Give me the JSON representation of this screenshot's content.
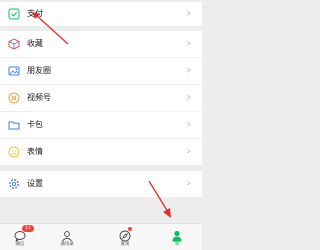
{
  "menu": {
    "pay": {
      "label": "支付",
      "icon": "wechat-pay-icon",
      "color": "#07c160"
    },
    "favorites": {
      "label": "收藏",
      "icon": "favorites-cube-icon"
    },
    "moments": {
      "label": "朋友圈",
      "icon": "moments-image-icon"
    },
    "channels": {
      "label": "视频号",
      "icon": "channels-icon"
    },
    "cards": {
      "label": "卡包",
      "icon": "card-wallet-icon"
    },
    "stickers": {
      "label": "表情",
      "icon": "sticker-smile-icon"
    },
    "settings": {
      "label": "设置",
      "icon": "settings-gear-icon"
    }
  },
  "tabbar": {
    "chats": {
      "label": "微信",
      "icon": "chat-bubble-icon",
      "badge": "11"
    },
    "contacts": {
      "label": "通讯录",
      "icon": "contacts-icon"
    },
    "discover": {
      "label": "发现",
      "icon": "compass-icon"
    },
    "me": {
      "label": "我",
      "icon": "person-icon",
      "color": "#07c160"
    }
  },
  "annotation_color": "#e0302b"
}
